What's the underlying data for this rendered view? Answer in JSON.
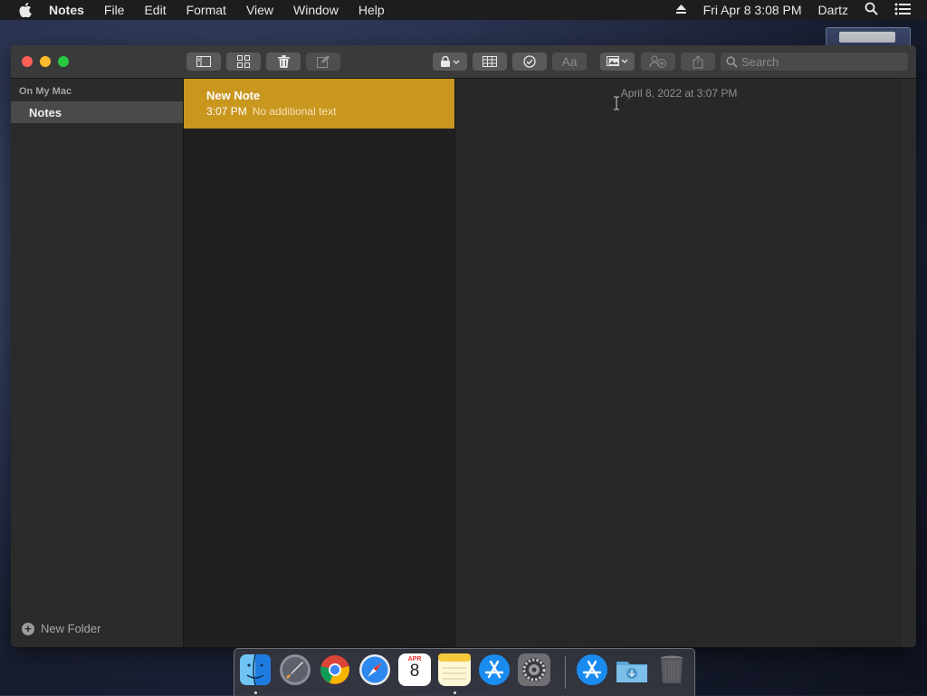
{
  "menubar": {
    "app_name": "Notes",
    "menus": [
      "File",
      "Edit",
      "Format",
      "View",
      "Window",
      "Help"
    ],
    "clock": "Fri Apr 8  3:08 PM",
    "user": "Dartz"
  },
  "toolbar": {
    "search_placeholder": "Search",
    "format_label": "Aa"
  },
  "sidebar": {
    "section": "On My Mac",
    "folders": [
      {
        "label": "Notes"
      }
    ],
    "new_folder_label": "New Folder"
  },
  "notes": [
    {
      "title": "New Note",
      "time": "3:07 PM",
      "preview": "No additional text"
    }
  ],
  "editor": {
    "date": "April 8, 2022 at 3:07 PM"
  },
  "dock": {
    "apps": [
      "Finder",
      "Launchpad",
      "Google Chrome",
      "Safari",
      "Calendar",
      "Notes",
      "App Store",
      "System Preferences",
      "App Store",
      "Downloads",
      "Trash"
    ],
    "calendar_month": "APR",
    "calendar_day": "8"
  },
  "colors": {
    "selected_note": "#c9961e",
    "close": "#fe5f57",
    "minimize": "#febc2e",
    "zoom": "#28c840"
  }
}
